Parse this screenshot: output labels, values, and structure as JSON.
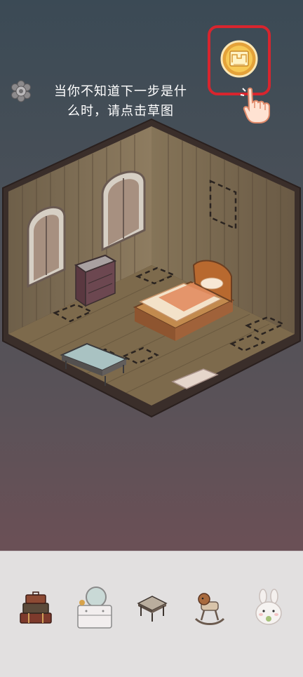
{
  "hint": {
    "line1": "当你不知道下一步是什",
    "line2": "么时，请点击草图"
  },
  "icons": {
    "settings": "gear-flower-icon",
    "blueprint": "blueprint-icon",
    "hand": "pointing-hand-icon"
  },
  "colors": {
    "highlight": "#d8252e",
    "blueprint_gold": "#f2b53a",
    "tray": "#e2e0e0"
  },
  "tray_items": [
    {
      "name": "suitcase-stack-item"
    },
    {
      "name": "vanity-dresser-item"
    },
    {
      "name": "small-table-item"
    },
    {
      "name": "rocking-horse-item"
    },
    {
      "name": "bunny-plush-item"
    }
  ]
}
